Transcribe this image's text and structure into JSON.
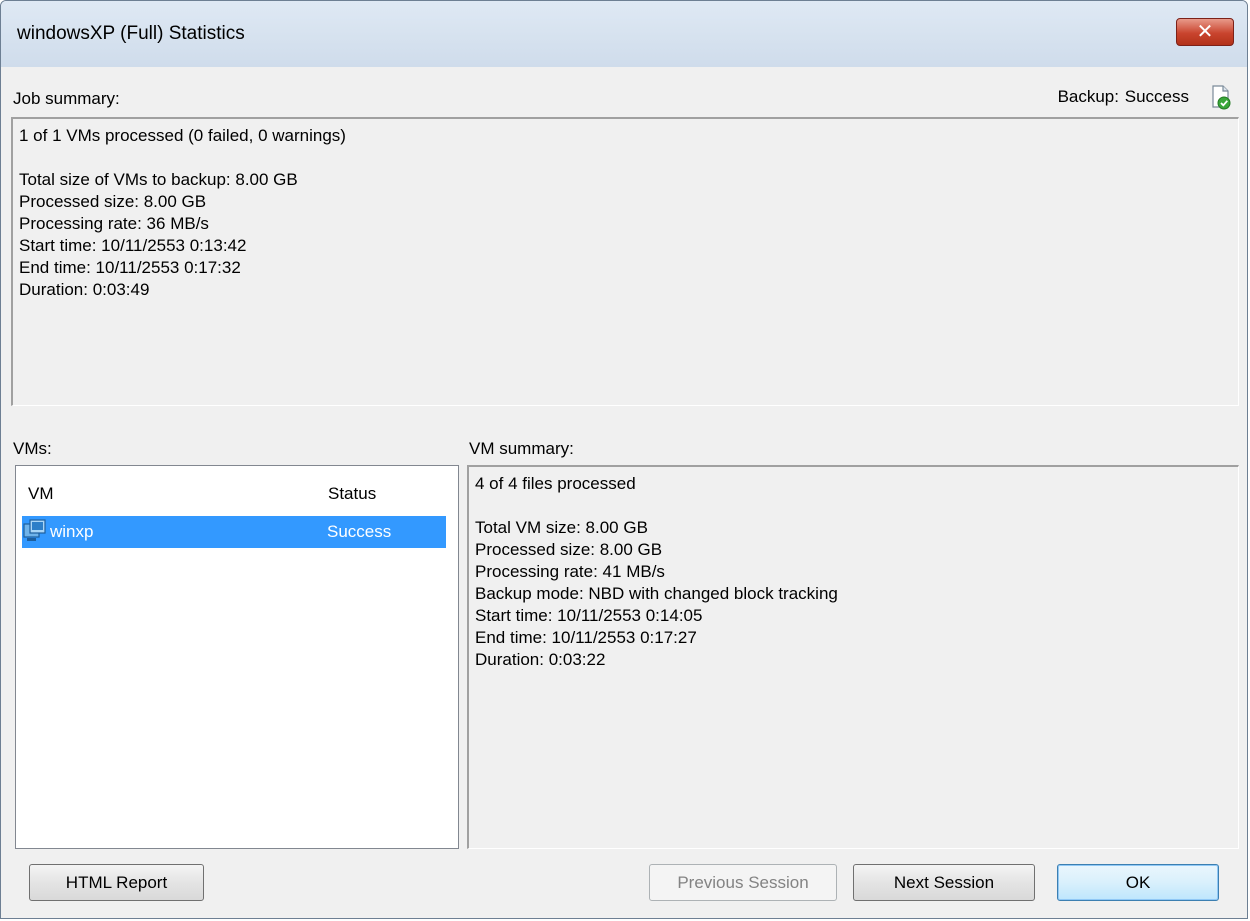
{
  "window": {
    "title": "windowsXP (Full) Statistics",
    "close_label": "✕"
  },
  "job": {
    "label": "Job summary:",
    "backup_status_label": "Backup:",
    "backup_status_value": "Success",
    "status_icon": "document-check-icon",
    "lines": [
      "1 of 1 VMs processed (0 failed, 0 warnings)",
      "",
      "Total size of VMs to backup: 8.00 GB",
      "Processed size: 8.00 GB",
      "Processing rate: 36 MB/s",
      "Start time: 10/11/2553 0:13:42",
      "End time: 10/11/2553 0:17:32",
      "Duration: 0:03:49"
    ]
  },
  "vms": {
    "label": "VMs:",
    "columns": [
      "VM",
      "Status"
    ],
    "rows": [
      {
        "icon": "vm-icon",
        "name": "winxp",
        "status": "Success",
        "selected": true
      }
    ]
  },
  "vm_summary": {
    "label": "VM summary:",
    "lines": [
      "4 of 4 files processed",
      "",
      "Total VM size: 8.00 GB",
      "Processed size: 8.00 GB",
      "Processing rate: 41 MB/s",
      "Backup mode: NBD with changed block tracking",
      "Start time: 10/11/2553 0:14:05",
      "End time: 10/11/2553 0:17:27",
      "Duration: 0:03:22"
    ]
  },
  "buttons": {
    "html_report": "HTML Report",
    "previous_session": "Previous Session",
    "next_session": "Next Session",
    "ok": "OK"
  },
  "colors": {
    "selection": "#3399ff",
    "titlebar": "#dfe9f4",
    "close": "#c9442e",
    "success_icon": "#3aa63a"
  }
}
